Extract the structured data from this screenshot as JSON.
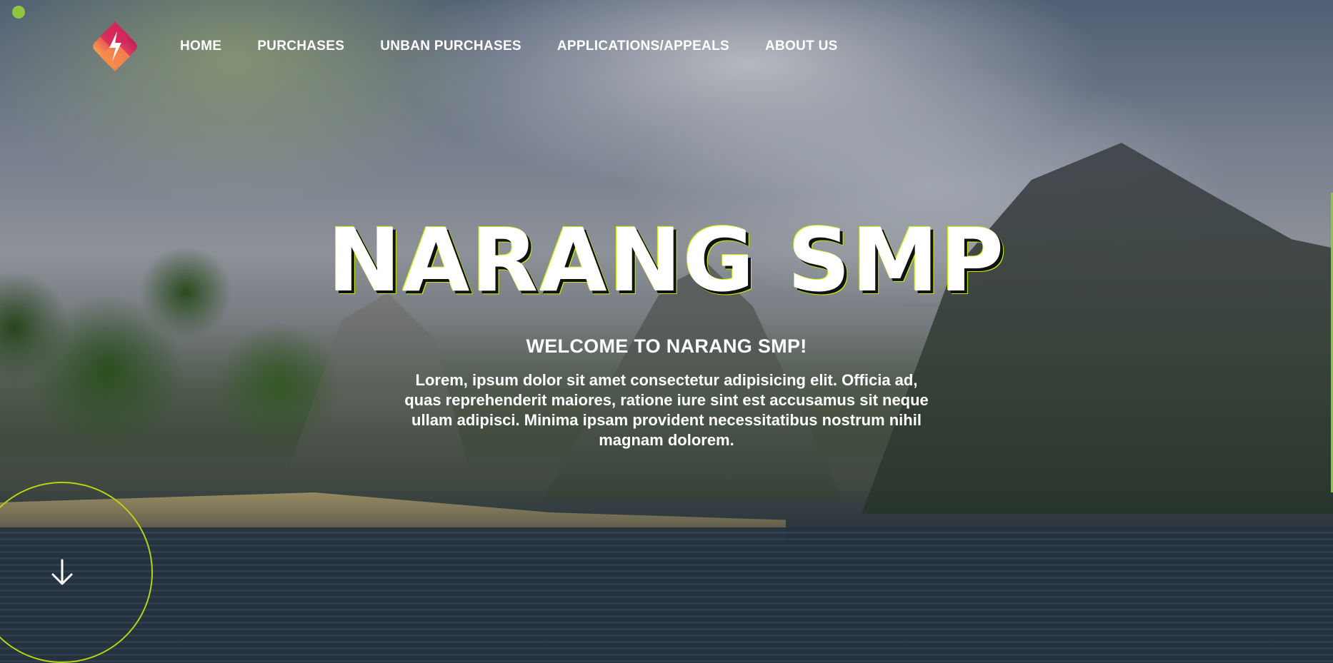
{
  "nav": {
    "logo_icon": "diamond-logo-icon",
    "items": [
      {
        "label": "HOME"
      },
      {
        "label": "PURCHASES"
      },
      {
        "label": "UNBAN PURCHASES"
      },
      {
        "label": "APPLICATIONS/APPEALS"
      },
      {
        "label": "ABOUT US"
      }
    ]
  },
  "hero": {
    "title": "NARANG SMP",
    "subtitle": "WELCOME TO NARANG SMP!",
    "text": "Lorem, ipsum dolor sit amet consectetur adipisicing elit. Officia ad, quas reprehenderit maiores, ratione iure sint est accusamus sit neque ullam adipisci. Minima ipsam provident necessitatibus nostrum nihil magnam dolorem."
  },
  "scroll": {
    "icon": "arrow-down-icon"
  },
  "colors": {
    "accent": "#c6f000",
    "circle": "#b5d30f",
    "dot": "#8ec63f",
    "logo_top": "#e0345e",
    "logo_bottom": "#f7a04a"
  }
}
